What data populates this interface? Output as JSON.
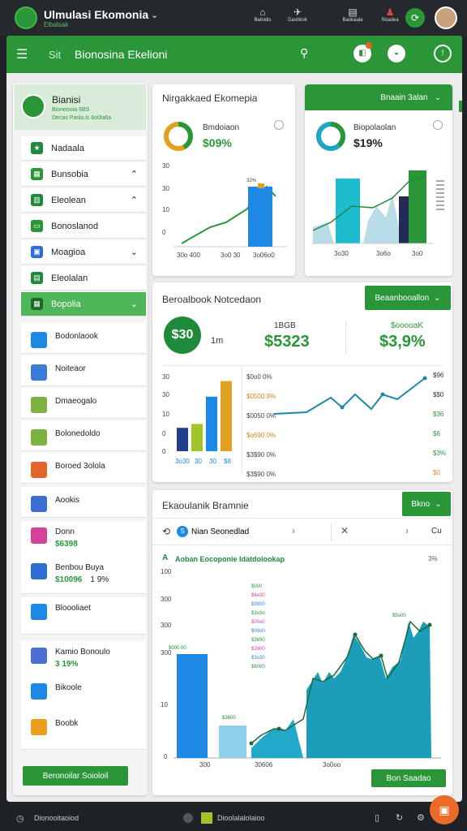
{
  "topbar": {
    "title": "Ulmulasi Ekomonia",
    "subtitle": "Elbalsak",
    "icons": [
      {
        "name": "home-icon",
        "label": "Baloidis"
      },
      {
        "name": "plane-icon",
        "label": "Dashbok"
      },
      {
        "name": "inbox-icon",
        "label": "Baokaala"
      },
      {
        "name": "bell-icon",
        "label": "Sloailea"
      }
    ]
  },
  "header": {
    "title_prefix": "Sit",
    "title": "Bionosina Ekelioni"
  },
  "sidebar": {
    "user": {
      "name": "Bianisi",
      "meta1": "Bioneooia 6BS",
      "meta2": "Decas Paslo.ls 6o0la6a"
    },
    "items": [
      {
        "label": "Nadaala",
        "icon": "star-icon",
        "color": "#1f8a3a"
      },
      {
        "label": "Bunsobia",
        "icon": "chart-icon",
        "color": "#2a9638",
        "chev": "up"
      },
      {
        "label": "Eleolean",
        "icon": "document-icon",
        "color": "#1f8a3a",
        "chev": "up"
      },
      {
        "label": "Bonoslanod",
        "icon": "wallet-icon",
        "color": "#2a9638"
      },
      {
        "label": "Moagioa",
        "icon": "calendar-icon",
        "color": "#2b6fd6",
        "chev": "down"
      },
      {
        "label": "Eleolalan",
        "icon": "file-icon",
        "color": "#1f8a3a"
      },
      {
        "label": "Bopolia",
        "icon": "grid-icon",
        "color": "#1f8a3a",
        "chev": "down",
        "active": true
      }
    ],
    "cards": [
      {
        "label": "Bodonlaook",
        "color": "#1e88e5"
      },
      {
        "label": "Noiteaor",
        "color": "#3a7bd5"
      },
      {
        "label": "Dmaeogalo",
        "color": "#7cb342"
      },
      {
        "label": "Bolonedoldo",
        "color": "#7cb342"
      },
      {
        "label": "Boroed 3olola",
        "color": "#e0662a"
      },
      {
        "label": "Aookis",
        "color": "#3a6fd0"
      },
      {
        "label": "Donn",
        "value": "$6398",
        "color": "#d6429a"
      },
      {
        "label": "Benbou Buya",
        "value": "$10096",
        "value2": "1 9%",
        "color": "#2b6fd6"
      },
      {
        "label": "Bloooliaet",
        "color": "#1e88e5"
      },
      {
        "label": "Kamio Bonoulo",
        "value": "3 19%",
        "color": "#4a6fd0"
      },
      {
        "label": "Bikoole",
        "color": "#1e88e5"
      },
      {
        "label": "Boobk",
        "color": "#e8a020"
      }
    ],
    "footer_button": "Beronoilar Soioloil"
  },
  "card1": {
    "title": "Nirgakkaed Ekomepia",
    "metric_label": "Bmdoiaon",
    "metric_value": "$09%",
    "yticks": [
      "30",
      "30",
      "10",
      "0"
    ],
    "xticks": [
      "30o 400",
      "3o0 30",
      "3o06o0"
    ],
    "bar_label": "32%"
  },
  "card2": {
    "button": "Bnaain 3alan",
    "metric_label": "Biopolaolan",
    "metric_value": "$19%",
    "xticks": [
      "3o30",
      "3o6o",
      "3o0"
    ]
  },
  "card3": {
    "title": "Beroalbook Notcedaon",
    "button": "Beaanbooallon",
    "badge": "$30",
    "badge_side": "1m",
    "m1_label": "1BGB",
    "m1_value": "$5323",
    "m2_label": "$ooooaK",
    "m2_value": "$3,9%",
    "yticks": [
      "30",
      "30",
      "10",
      "0",
      "0"
    ],
    "xticks": [
      "3o30",
      "30",
      "30",
      "$8"
    ],
    "bar_labels": [
      "$0",
      "$0",
      "$0"
    ],
    "rows": [
      "$0o0 0%",
      "$0500 8%",
      "$0050 0%",
      "$o690 0%",
      "$3$90 0%",
      "$3$90 0%"
    ],
    "right": [
      "$96",
      "$$0",
      "$36",
      "$6",
      "$3%",
      "$0"
    ]
  },
  "chart_data": {
    "type": "bar",
    "categories": [
      "1",
      "2",
      "3",
      "4"
    ],
    "series": [
      {
        "values": [
          12,
          14,
          28,
          36
        ]
      }
    ]
  },
  "card4": {
    "title": "Ekaoulanik Bramnie",
    "button": "Bkno",
    "search": "Nian Seonedlad",
    "search_right": "Cu",
    "chart_title": "Aoban Eocoponie Idatdolookap",
    "chart_right": "3%",
    "yticks": [
      "100",
      "300",
      "300",
      "300",
      "10",
      "0"
    ],
    "xticks": [
      "300",
      "30606",
      "3o0oo"
    ],
    "floating": [
      "$000",
      "$6o30",
      "$3900",
      "$3o3o",
      "$00o0",
      "$00o0",
      "$3690",
      "$3900",
      "$3o30",
      "$6000"
    ],
    "bar_labels": [
      "$000 00",
      "$3600"
    ],
    "peak_label": "$5o00",
    "footer_button": "Bon Saadao"
  },
  "bottombar": {
    "left": "Dionooitaoiod",
    "center": "Dioolalalolaioo"
  },
  "colors": {
    "green": "#2a9638",
    "blue": "#1e88e5",
    "teal": "#1ea7c3"
  }
}
